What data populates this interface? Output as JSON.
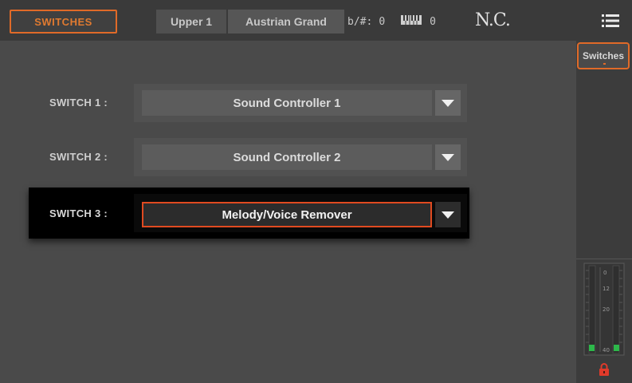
{
  "header": {
    "page_tab": "SWITCHES",
    "part": "Upper 1",
    "sound": "Austrian Grand",
    "transpose_label": "b/#:",
    "transpose_value": "0",
    "octave_value": "0",
    "chord": "N.C."
  },
  "side": {
    "tab_label": "Switches",
    "meter_ticks": [
      "0",
      "12",
      "20",
      "40"
    ]
  },
  "switches": [
    {
      "label": "SWITCH 1 :",
      "value": "Sound Controller 1",
      "active": false
    },
    {
      "label": "SWITCH 2 :",
      "value": "Sound Controller 2",
      "active": false
    },
    {
      "label": "SWITCH 3 :",
      "value": "Melody/Voice Remover",
      "active": true
    }
  ],
  "colors": {
    "accent": "#e06a28",
    "active_border": "#e04a20",
    "background": "#4a4a4a",
    "meter_green": "#2db84a",
    "lock_red": "#e03a2a"
  }
}
